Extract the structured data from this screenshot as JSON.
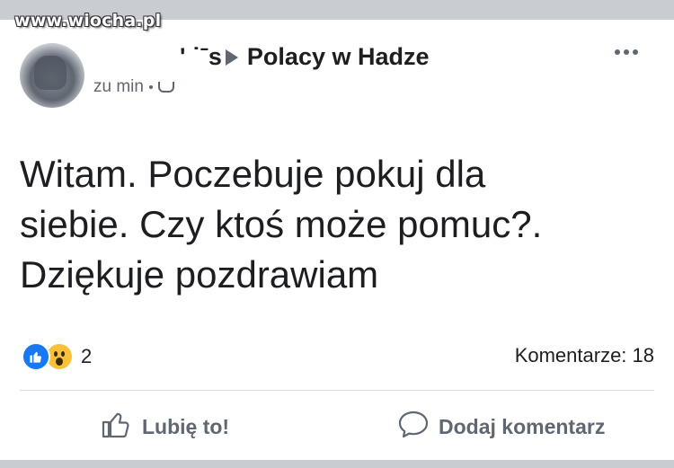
{
  "watermark": {
    "text": "www.wiocha.pl"
  },
  "post": {
    "author_fragment": "' ˙ˉs",
    "group_name": "Polacy w Hadze",
    "time": "zu min",
    "text": "Witam.  Poczebuje pokuj dla\nsiebie.  Czy ktoś może pomuc?.\nDziękuje pozdrawiam"
  },
  "stats": {
    "reaction_count": "2",
    "comments": "Komentarze: 18"
  },
  "actions": {
    "like_label": "Lubię to!",
    "comment_label": "Dodaj komentarz"
  },
  "icons": [
    "more-options-icon",
    "audience-icon",
    "like-reaction-icon",
    "wow-reaction-icon",
    "thumbs-up-icon",
    "speech-bubble-icon"
  ],
  "colors": {
    "like_blue": "#1877f2",
    "wow_yellow": "#f7c23a",
    "muted_gray": "#606770"
  }
}
